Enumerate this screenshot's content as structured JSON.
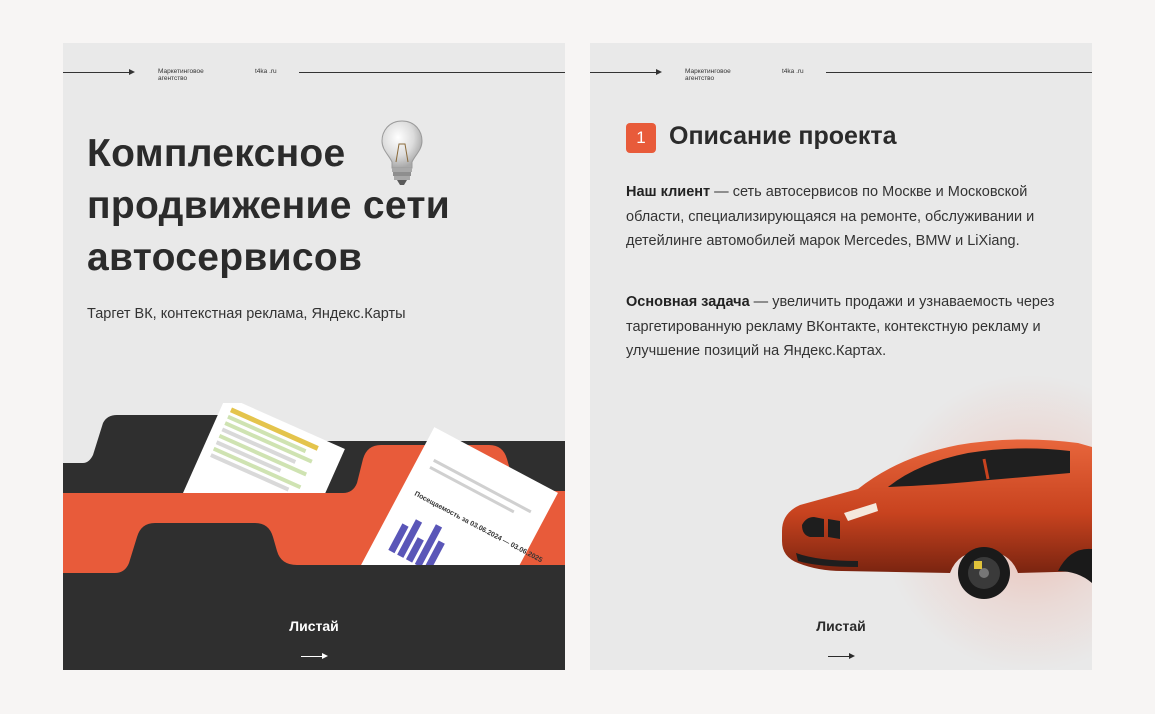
{
  "header": {
    "agency_label": "Маркетинговое агентство",
    "site_label": "t4ka .ru"
  },
  "left_card": {
    "title": "Комплексное продвижение сети автосервисов",
    "subtitle": "Таргет ВК, контекстная реклама, Яндекс.Карты",
    "swipe_label": "Листай",
    "document_caption": "Посещаемость за 03.06.2024 — 03.06.2025"
  },
  "right_card": {
    "step_number": "1",
    "section_title": "Описание проекта",
    "client_label": "Наш клиент",
    "client_text": " — сеть автосервисов по Москве и Московской области, специализирующаяся на ремонте, обслуживании и детейлинге автомобилей марок Mercedes, BMW и LiXiang.",
    "task_label": "Основная задача",
    "task_text": " — увеличить продажи и узнаваемость через таргетированную рекламу ВКонтакте, контекстную рекламу и улучшение позиций на Яндекс.Картах.",
    "swipe_label": "Листай"
  },
  "colors": {
    "accent": "#e85b3a",
    "dark": "#2b2b2b",
    "card_bg": "#e9e9e9",
    "page_bg": "#f7f5f4"
  }
}
